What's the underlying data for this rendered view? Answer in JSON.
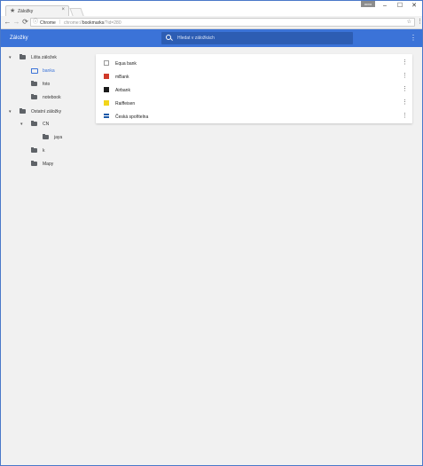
{
  "browser": {
    "tab_title": "Záložky",
    "tab_close": "×",
    "user_badge": "ocvo",
    "window_buttons": {
      "minimize": "–",
      "maximize": "☐",
      "close": "✕"
    },
    "nav": {
      "back": "←",
      "forward": "→",
      "reload": "⟳"
    },
    "omnibox": {
      "info_icon": "ⓘ",
      "scheme_label": "Chrome",
      "separator": "|",
      "url_prefix": "chrome://",
      "url_host": "bookmarks",
      "url_suffix": "/?id=280",
      "star": "☆"
    },
    "menu": "⋮"
  },
  "app": {
    "title": "Záložky",
    "search_placeholder": "Hledat v záložkách",
    "menu": "⋮"
  },
  "sidebar": {
    "nodes": [
      {
        "label": "Lišta záložek",
        "arrow": "▾",
        "selected": false
      },
      {
        "label": "banka",
        "arrow": "",
        "selected": true
      },
      {
        "label": "foto",
        "arrow": "",
        "selected": false
      },
      {
        "label": "notebook",
        "arrow": "",
        "selected": false
      },
      {
        "label": "Ostatní záložky",
        "arrow": "▾",
        "selected": false
      },
      {
        "label": "CN",
        "arrow": "▾",
        "selected": false
      },
      {
        "label": "jaya",
        "arrow": "",
        "selected": false
      },
      {
        "label": "k",
        "arrow": "",
        "selected": false
      },
      {
        "label": "Mapy",
        "arrow": "",
        "selected": false
      }
    ]
  },
  "bookmarks": [
    {
      "title": "Equa bank",
      "favicon_color": "#9a9a9a",
      "more": "⋮"
    },
    {
      "title": "mBank",
      "favicon_color": "#d03a2a",
      "more": "⋮"
    },
    {
      "title": "Airbank",
      "favicon_color": "#1a1a1a",
      "more": "⋮"
    },
    {
      "title": "Raiffeisen",
      "favicon_color": "#f2d51b",
      "more": "⋮"
    },
    {
      "title": "Česká spořitelna",
      "favicon_color": "#1e5aa8",
      "more": "⋮"
    }
  ]
}
